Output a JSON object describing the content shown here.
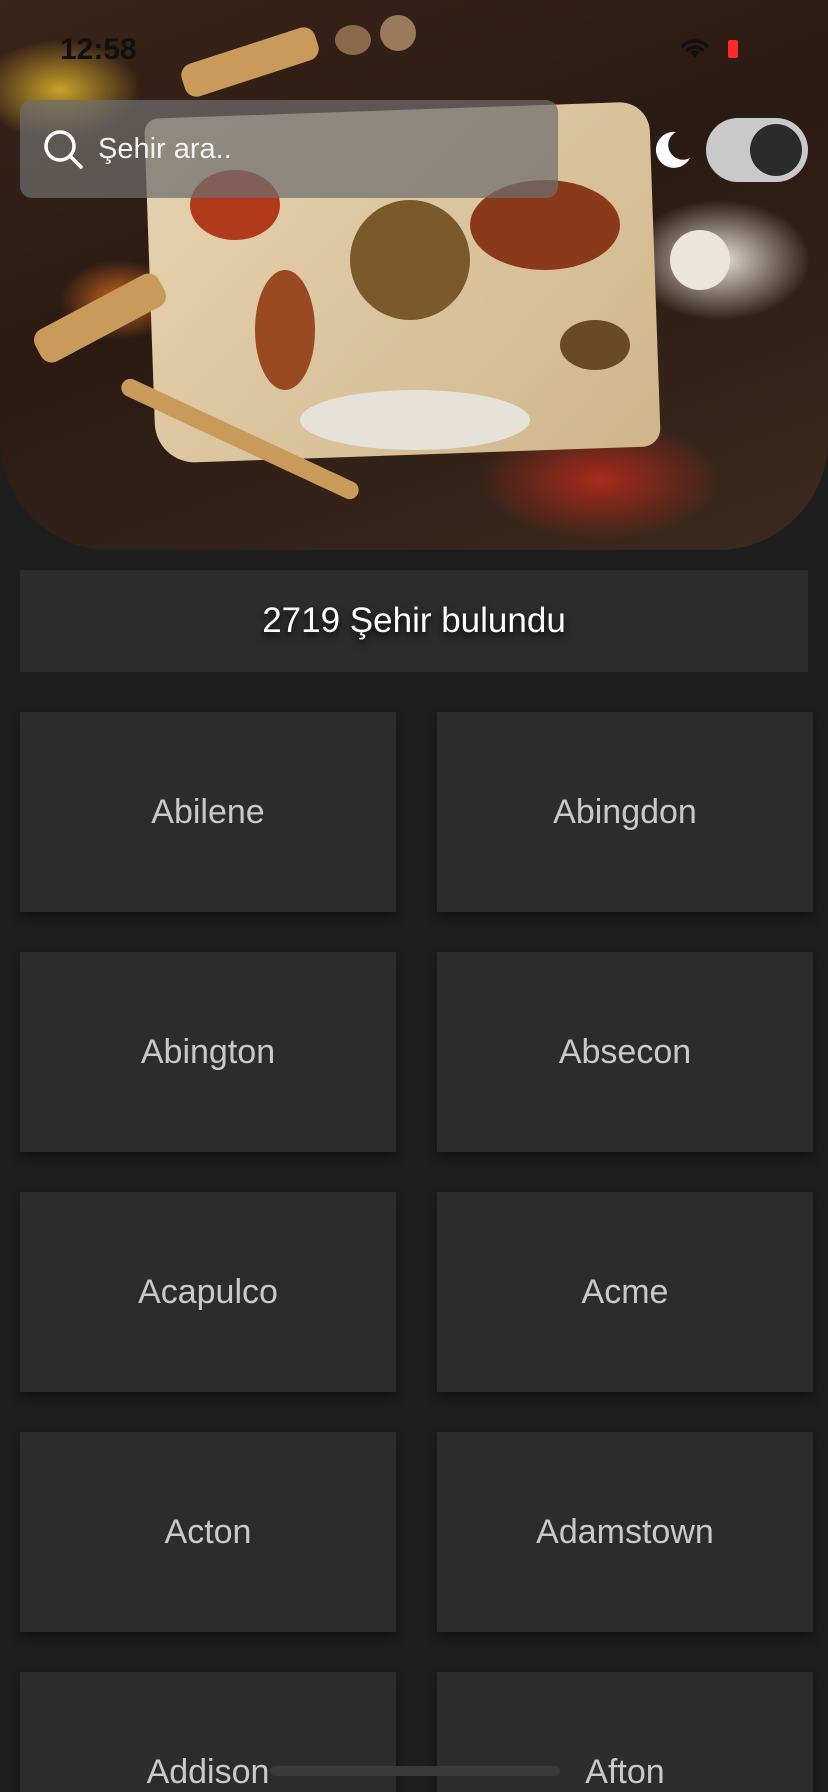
{
  "status_bar": {
    "time": "12:58",
    "wifi_icon": "wifi-icon",
    "battery_color": "#ff2a2a"
  },
  "search": {
    "placeholder": "Şehir ara..",
    "icon": "search-icon"
  },
  "theme_toggle": {
    "icon": "moon-icon",
    "dark_mode": true
  },
  "results": {
    "count_text": "2719 Şehir bulundu"
  },
  "cities": [
    "Abilene",
    "Abingdon",
    "Abington",
    "Absecon",
    "Acapulco",
    "Acme",
    "Acton",
    "Adamstown",
    "Addison",
    "Afton"
  ],
  "colors": {
    "background": "#1e1e1e",
    "card": "#2c2c2c",
    "card_text": "#c9c9c9"
  }
}
